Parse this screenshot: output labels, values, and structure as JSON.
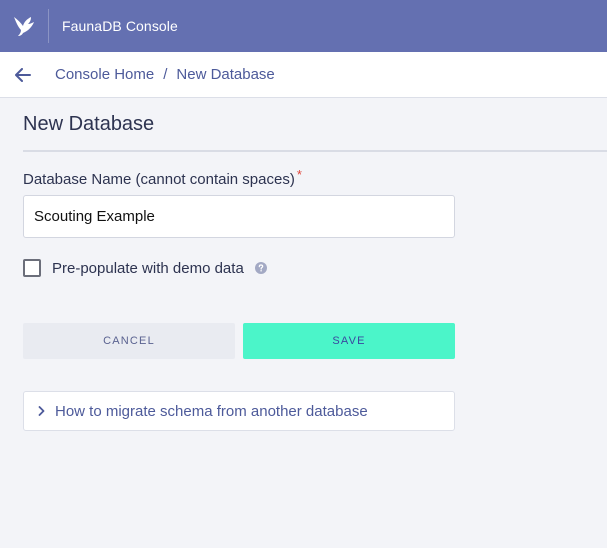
{
  "colors": {
    "topbar": "#6470b1",
    "accent_save": "#4bf5c9",
    "link": "#4d5a9a",
    "required": "#e0453a"
  },
  "topbar": {
    "logo_icon": "fauna-bird-logo-icon",
    "app_title": "FaunaDB Console"
  },
  "breadcrumb": {
    "back_icon": "arrow-left-icon",
    "home": "Console Home",
    "separator": "/",
    "current": "New Database"
  },
  "page": {
    "title": "New Database"
  },
  "form": {
    "name_label": "Database Name (cannot contain spaces)",
    "required_marker": "*",
    "name_value": "Scouting Example",
    "prepopulate_label": "Pre-populate with demo data",
    "prepopulate_checked": false,
    "help_icon": "question-circle-icon",
    "cancel_label": "CANCEL",
    "save_label": "SAVE"
  },
  "accordion": {
    "icon": "chevron-right-icon",
    "label": "How to migrate schema from another database"
  }
}
